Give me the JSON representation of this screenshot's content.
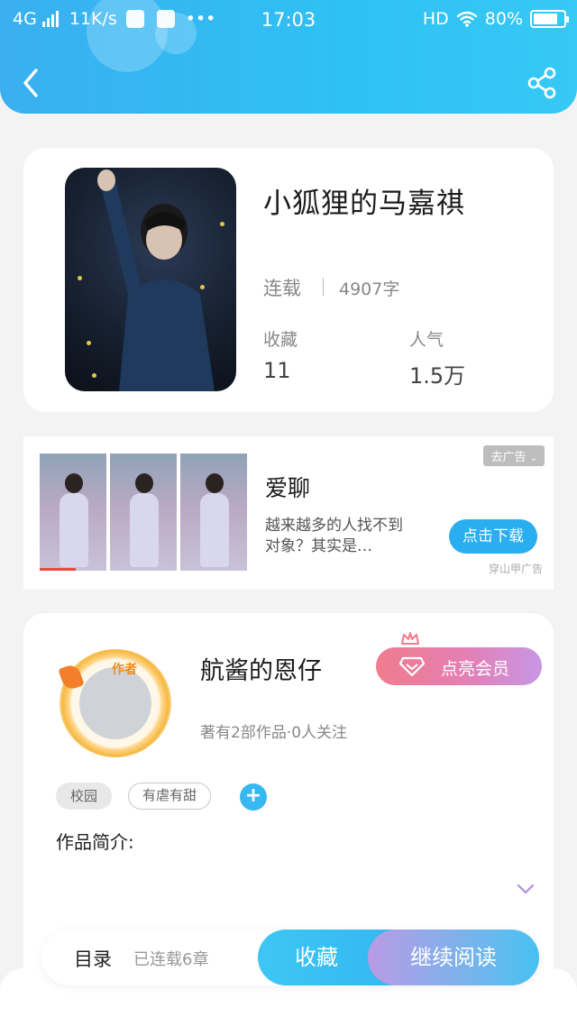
{
  "status_bar": {
    "network": "4G",
    "speed": "11K/s",
    "dots": "•••",
    "time": "17:03",
    "hd": "HD",
    "battery": "80%",
    "battery_level": 0.8
  },
  "book": {
    "title": "小狐狸的马嘉祺",
    "status": "连载",
    "word_count": "4907字",
    "stats": [
      {
        "label": "收藏",
        "value": "11"
      },
      {
        "label": "人气",
        "value": "1.5万"
      }
    ]
  },
  "ad": {
    "title": "爱聊",
    "description": "越来越多的人找不到对象？其实是…",
    "remove_label": "去广告",
    "button_label": "点击下载",
    "source": "穿山甲广告"
  },
  "author": {
    "avatar_tag": "作者",
    "name": "航酱的恩仔",
    "meta": "著有2部作品·0人关注",
    "vip_label": "点亮会员"
  },
  "tags": [
    "校园",
    "有虐有甜"
  ],
  "intro_label": "作品简介:",
  "bottom_bar": {
    "toc_label": "目录",
    "chapters": "已连载6章",
    "favorite_label": "收藏",
    "continue_label": "继续阅读"
  },
  "colors": {
    "header_gradient_start": "#3aaff0",
    "accent_blue": "#29aef2",
    "vip_pink": "#f07c8d",
    "vip_purple": "#c797e6"
  }
}
